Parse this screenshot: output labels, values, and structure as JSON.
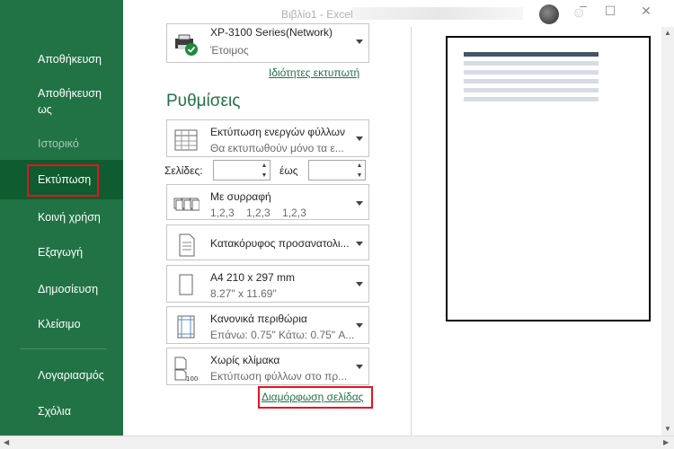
{
  "window": {
    "title": "Βιβλίο1 - Excel"
  },
  "sidebar": {
    "items": [
      {
        "label": "Αποθήκευση"
      },
      {
        "label": "Αποθήκευση ως"
      },
      {
        "label": "Ιστορικό"
      },
      {
        "label": "Εκτύπωση"
      },
      {
        "label": "Κοινή χρήση"
      },
      {
        "label": "Εξαγωγή"
      },
      {
        "label": "Δημοσίευση"
      },
      {
        "label": "Κλείσιμο"
      },
      {
        "label": "Λογαριασμός"
      },
      {
        "label": "Σχόλια"
      }
    ]
  },
  "printer": {
    "name": "XP-3100 Series(Network)",
    "status": "Έτοιμος",
    "properties_link": "Ιδιότητες εκτυπωτή"
  },
  "settings": {
    "heading": "Ρυθμίσεις",
    "what_to_print": {
      "line1": "Εκτύπωση ενεργών φύλλων",
      "line2": "Θα εκτυπωθούν μόνο τα ε..."
    },
    "pages_label": "Σελίδες:",
    "to_label": "έως",
    "collation": {
      "line1": "Με συρραφή",
      "line2": "1,2,3    1,2,3    1,2,3"
    },
    "orientation": {
      "line1": "Κατακόρυφος προσανατολι..."
    },
    "paper": {
      "line1": "A4 210 x 297 mm",
      "line2": "8.27\" x 11.69\""
    },
    "margins": {
      "line1": "Κανονικά περιθώρια",
      "line2": "Επάνω: 0.75\" Κάτω: 0.75\" A..."
    },
    "scaling": {
      "line1": "Χωρίς κλίμακα",
      "line2": "Εκτύπωση φύλλων στο πρ..."
    },
    "page_setup_link": "Διαμόρφωση σελίδας"
  },
  "colors": {
    "brand": "#217346",
    "highlight": "#e81123"
  }
}
